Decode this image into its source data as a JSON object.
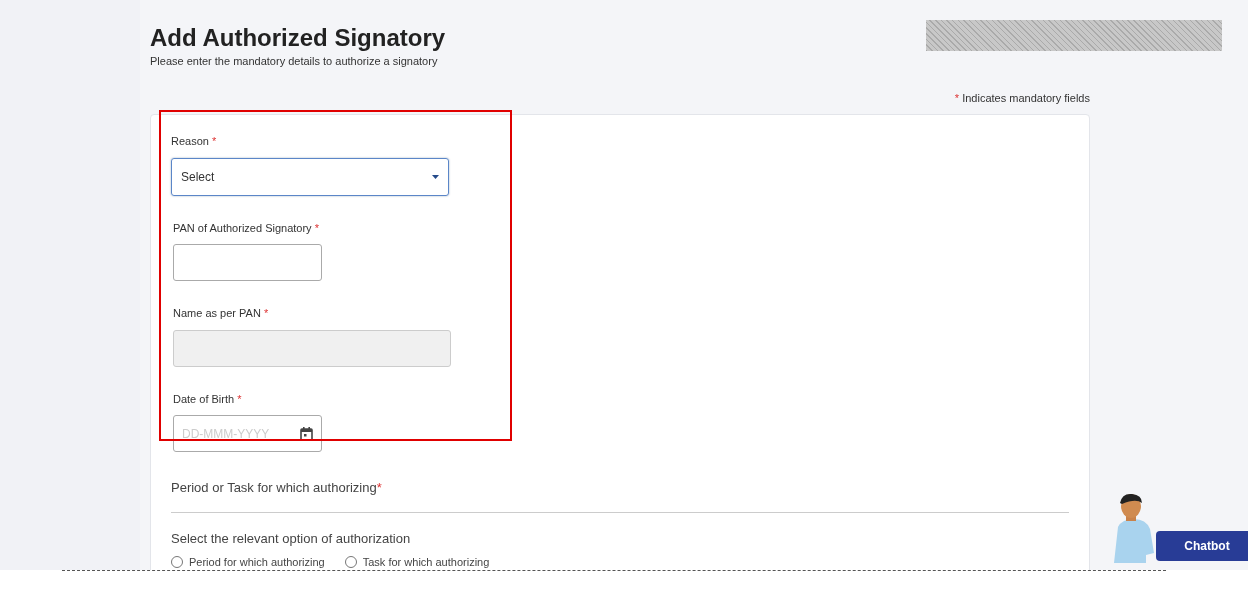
{
  "header": {
    "title": "Add Authorized Signatory",
    "subtitle": "Please enter the mandatory details to authorize a signatory"
  },
  "mandatory_note": {
    "mark": "*",
    "text": "Indicates mandatory fields"
  },
  "fields": [
    {
      "kind": "select",
      "label": "Reason",
      "required": true,
      "value": "Select",
      "focused": true
    },
    {
      "kind": "text",
      "label": "PAN of Authorized Signatory",
      "required": true,
      "disabled": false
    },
    {
      "kind": "text",
      "label": "Name as per PAN",
      "required": true,
      "disabled": true
    },
    {
      "kind": "date",
      "label": "Date of Birth",
      "required": true,
      "placeholder": "DD-MMM-YYYY"
    }
  ],
  "section": {
    "title": "Period or Task for which authorizing",
    "required": true,
    "prompt": "Select the relevant option of authorization",
    "options": [
      {
        "label": "Period for which authorizing",
        "selected": false
      },
      {
        "label": "Task for which authorizing",
        "selected": false
      }
    ]
  },
  "chatbot": {
    "label": "Chatbot"
  }
}
